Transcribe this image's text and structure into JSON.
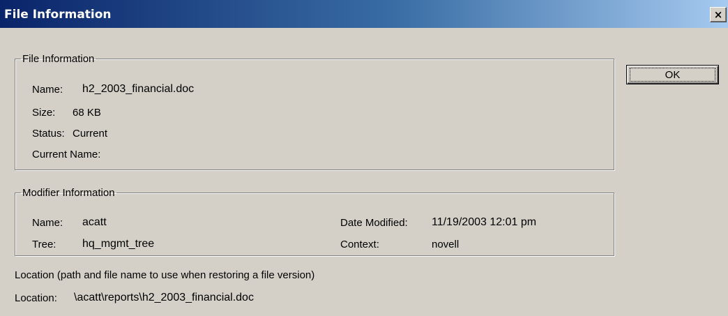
{
  "window": {
    "title": "File Information",
    "close_glyph": "×",
    "close_icon": "close-icon"
  },
  "file_info": {
    "group_title": "File Information",
    "name_label": "Name:",
    "name_value": "h2_2003_financial.doc",
    "size_label": "Size:",
    "size_value": "68 KB",
    "status_label": "Status:",
    "status_value": "Current",
    "current_name_label": "Current Name:",
    "current_name_value": ""
  },
  "modifier_info": {
    "group_title": "Modifier Information",
    "name_label": "Name:",
    "name_value": "acatt",
    "tree_label": "Tree:",
    "tree_value": "hq_mgmt_tree",
    "date_modified_label": "Date Modified:",
    "date_modified_value": "11/19/2003 12:01 pm",
    "context_label": "Context:",
    "context_value": "novell"
  },
  "location": {
    "description": "Location (path and file name to use when restoring a file version)",
    "label": "Location:",
    "value": "\\acatt\\reports\\h2_2003_financial.doc"
  },
  "buttons": {
    "ok_label": "OK"
  }
}
